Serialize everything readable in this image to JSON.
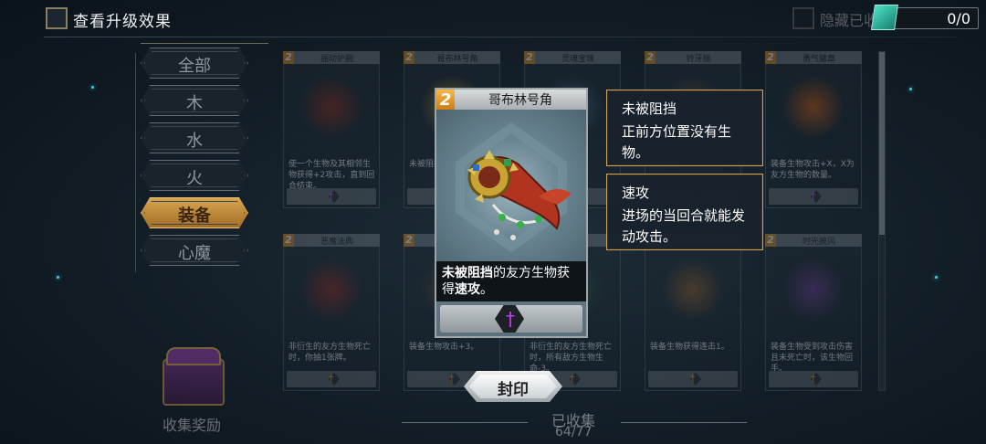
{
  "topbar": {
    "upgrade_label": "查看升级效果",
    "hide_label": "隐藏已收",
    "counter": "0/0"
  },
  "categories": [
    {
      "label": "全部",
      "active": false
    },
    {
      "label": "木",
      "active": false
    },
    {
      "label": "水",
      "active": false
    },
    {
      "label": "火",
      "active": false
    },
    {
      "label": "装备",
      "active": true
    },
    {
      "label": "心魔",
      "active": false
    }
  ],
  "chest": {
    "label": "收集奖励"
  },
  "cards": [
    {
      "cost": "2",
      "name": "振动护腕",
      "desc": "使一个生物及其相邻生物获得+2攻击，直到回合结束。",
      "art_color": "#8a2e20"
    },
    {
      "cost": "2",
      "name": "哥布林号角",
      "desc": "未被阻挡",
      "art_color": "#b8902e"
    },
    {
      "cost": "2",
      "name": "灵魂宝珠",
      "desc": "",
      "art_color": "#4e6a8a"
    },
    {
      "cost": "2",
      "name": "铃牙槌",
      "desc": "",
      "art_color": "#6a5a3a"
    },
    {
      "cost": "2",
      "name": "勇气徽章",
      "desc": "装备生物攻击+X，X为友方生物的数量。",
      "art_color": "#c25a18"
    },
    {
      "cost": "2",
      "name": "恶魔法典",
      "desc": "非衍生的友方生物死亡时，你抽1张牌。",
      "art_color": "#8a2a24"
    },
    {
      "cost": "2",
      "name": "",
      "desc": "装备生物攻击+3。",
      "art_color": "#7a4a2a"
    },
    {
      "cost": "2",
      "name": "",
      "desc": "非衍生的友方生物死亡时，所有敌方生物生命-3。",
      "art_color": "#2e5a3a"
    },
    {
      "cost": "2",
      "name": "",
      "desc": "装备生物获得连击1。",
      "art_color": "#8a5a2a"
    },
    {
      "cost": "2",
      "name": "时光披风",
      "desc": "装备生物受到攻击伤害且未死亡时，该生物回手。",
      "art_color": "#6a3a8a"
    }
  ],
  "selected_card": {
    "cost": "2",
    "name": "哥布林号角",
    "desc_kw1": "未被阻挡",
    "desc_mid": "的友方生物获得",
    "desc_kw2": "速攻",
    "desc_end": "。",
    "seal_label": "封印"
  },
  "keywords": [
    {
      "title": "未被阻挡",
      "desc": "正前方位置没有生物。"
    },
    {
      "title": "速攻",
      "desc": "进场的当回合就能发动攻击。"
    }
  ],
  "collection": {
    "label": "已收集",
    "count": "64/77"
  },
  "colors": {
    "gold": "#d7a550",
    "cost": "#d48c28",
    "keyword_border": "#c9a35d",
    "gem": "#4ee0c8"
  }
}
